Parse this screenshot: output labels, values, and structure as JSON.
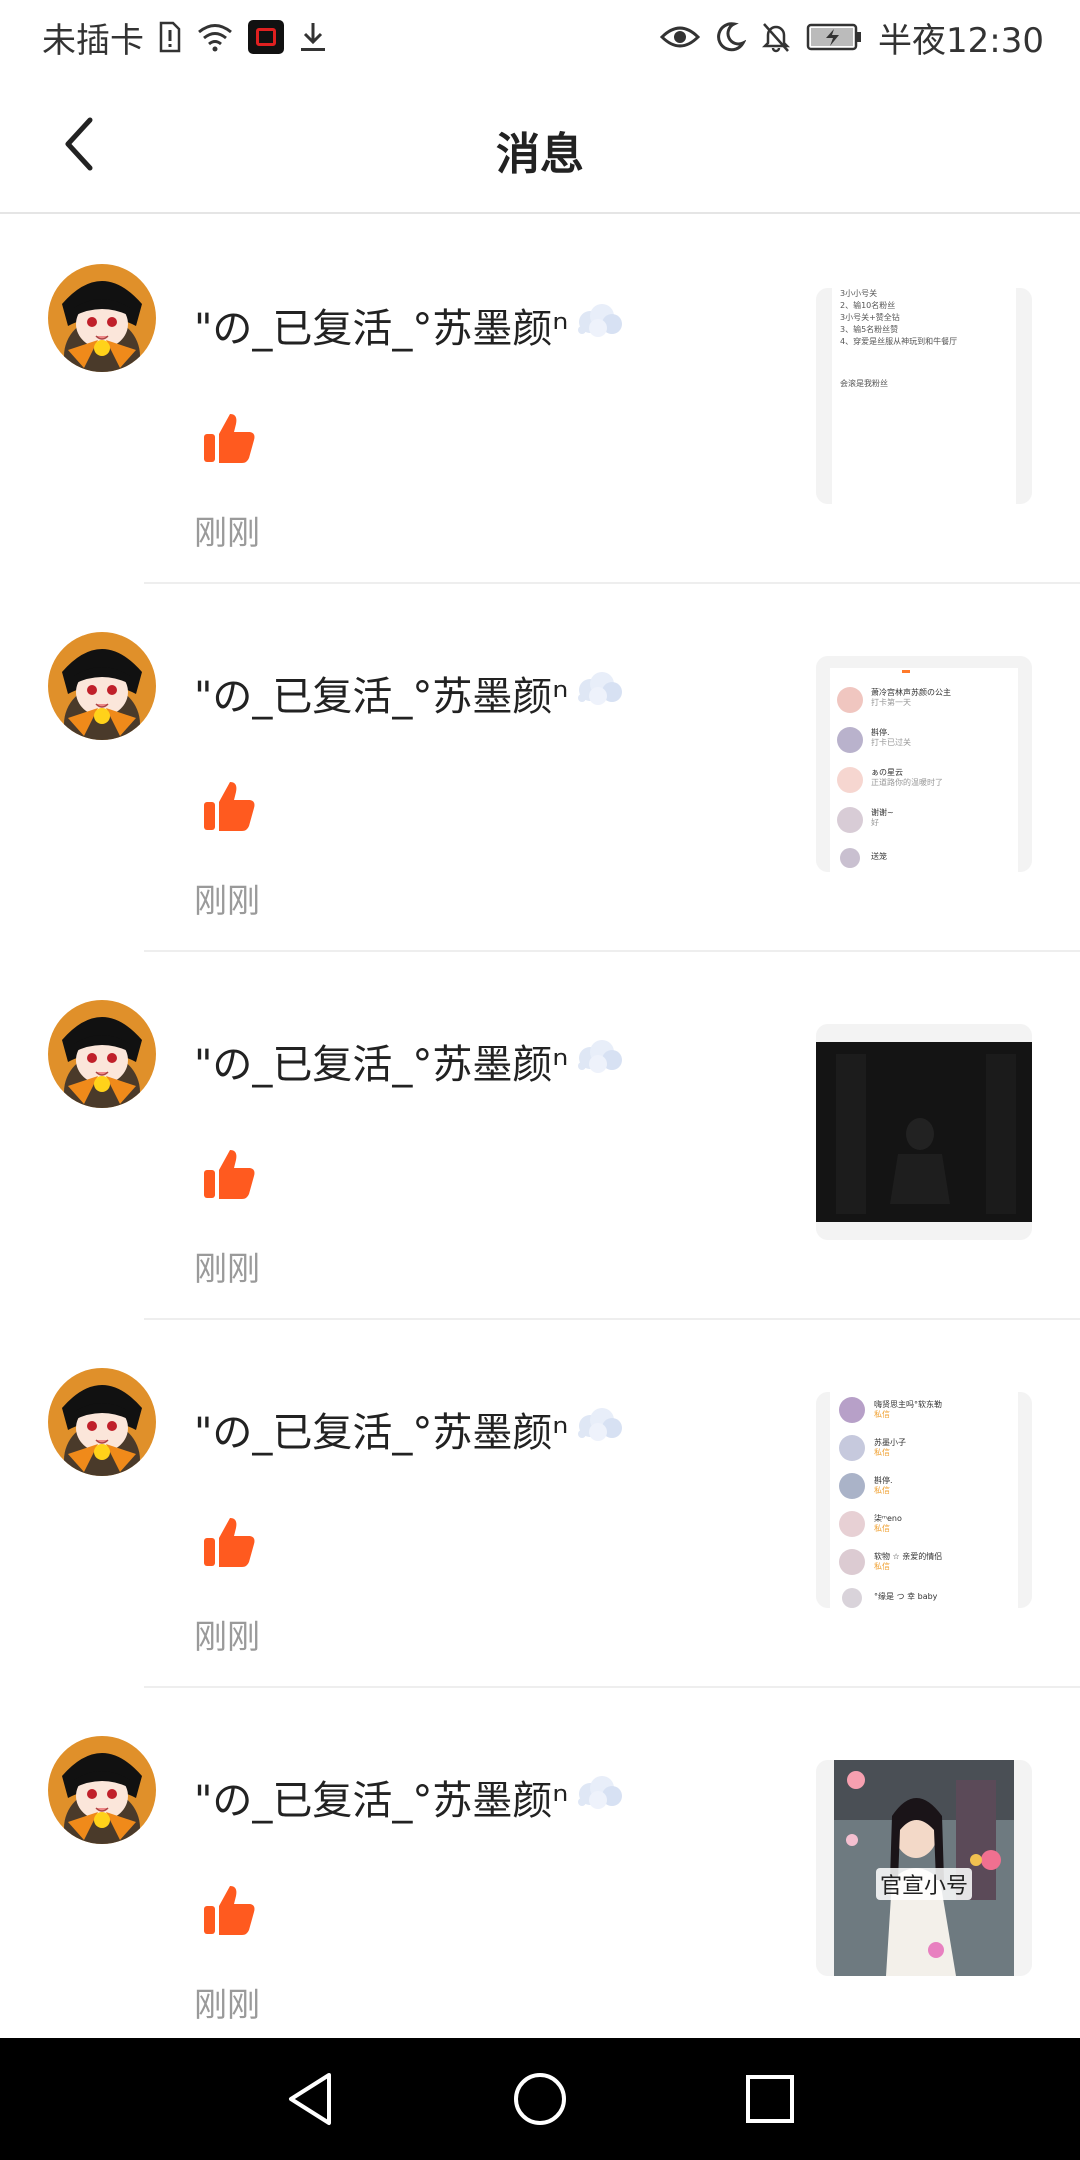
{
  "status_bar": {
    "carrier": "未插卡",
    "time": "半夜12:30"
  },
  "header": {
    "title": "消息"
  },
  "messages": [
    {
      "name": "\"の_已复活_°苏墨颜ⁿ",
      "time": "刚刚",
      "thumbnail": "note-screenshot"
    },
    {
      "name": "\"の_已复活_°苏墨颜ⁿ",
      "time": "刚刚",
      "thumbnail": "chat-list-screenshot"
    },
    {
      "name": "\"の_已复活_°苏墨颜ⁿ",
      "time": "刚刚",
      "thumbnail": "dark-photo"
    },
    {
      "name": "\"の_已复活_°苏墨颜ⁿ",
      "time": "刚刚",
      "thumbnail": "chat-list-screenshot"
    },
    {
      "name": "\"の_已复活_°苏墨颜ⁿ",
      "time": "刚刚",
      "thumbnail": "girl-photo-with-stickers"
    }
  ],
  "thumb_texts": {
    "note": {
      "lines": [
        "3小小号关",
        "2、输10名粉丝",
        "3小号关+赞全钻",
        "3、输5名粉丝赞",
        "4、穿爱是丝服从神玩到和牛餐厅",
        "会滚是我粉丝"
      ]
    },
    "chat1": {
      "rows": [
        {
          "title": "萧冷宫林声苏颜の公主",
          "sub": "打卡第一天"
        },
        {
          "title": "斟停.",
          "sub": "打卡已过关"
        },
        {
          "title": "ぁの星云",
          "sub": "正道路你的温暖时了"
        },
        {
          "title": "谢谢~",
          "sub": "好"
        },
        {
          "title": "送笼",
          "sub": ""
        }
      ]
    },
    "chat2": {
      "rows": [
        {
          "title": "嗨贤思主吗°软东勒",
          "sub": "私信"
        },
        {
          "title": "苏墨小子",
          "sub": "私信"
        },
        {
          "title": "斟停.",
          "sub": "私信"
        },
        {
          "title": "柒ᵐeno",
          "sub": "私信"
        },
        {
          "title": "软物 ☆ 亲爱的情侣",
          "sub": "私信"
        },
        {
          "title": "°缘是 つ 幸 baby",
          "sub": ""
        }
      ]
    },
    "photo_caption": "官宣小号"
  },
  "colors": {
    "like": "#ff5a1f",
    "time": "#9a9a9a",
    "navbar": "#000000"
  },
  "icons": {
    "back": "chevron-left-icon",
    "like": "thumbs-up-icon",
    "nav_back": "triangle-back-icon",
    "nav_home": "circle-home-icon",
    "nav_recents": "square-recents-icon"
  }
}
